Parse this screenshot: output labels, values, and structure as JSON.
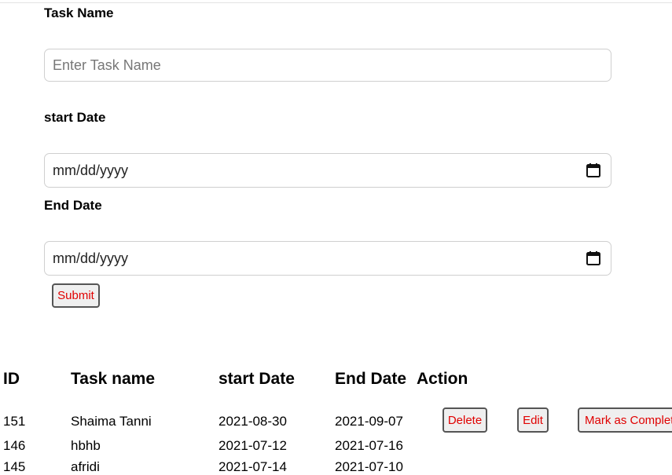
{
  "form": {
    "task_name_label": "Task Name",
    "task_name_placeholder": "Enter Task Name",
    "start_date_label": "start Date",
    "start_date_value": "mm/dd/yyyy",
    "end_date_label": "End Date",
    "end_date_value": "mm/dd/yyyy",
    "submit_label": "Submit"
  },
  "table": {
    "headers": [
      "ID",
      "Task name",
      "start Date",
      "End Date",
      "Action"
    ],
    "rows": [
      {
        "id": "151",
        "name": "Shaima Tanni",
        "start": "2021-08-30",
        "end": "2021-09-07"
      },
      {
        "id": "146",
        "name": "hbhb",
        "start": "2021-07-12",
        "end": "2021-07-16"
      },
      {
        "id": "145",
        "name": "afridi",
        "start": "2021-07-14",
        "end": "2021-07-10"
      }
    ],
    "actions": {
      "delete_label": "Delete",
      "edit_label": "Edit",
      "complete_label": "Mark as Complete"
    }
  },
  "colors": {
    "button_text": "#e00000",
    "border": "#cfcfcf"
  },
  "icons": [
    "calendar-icon"
  ]
}
